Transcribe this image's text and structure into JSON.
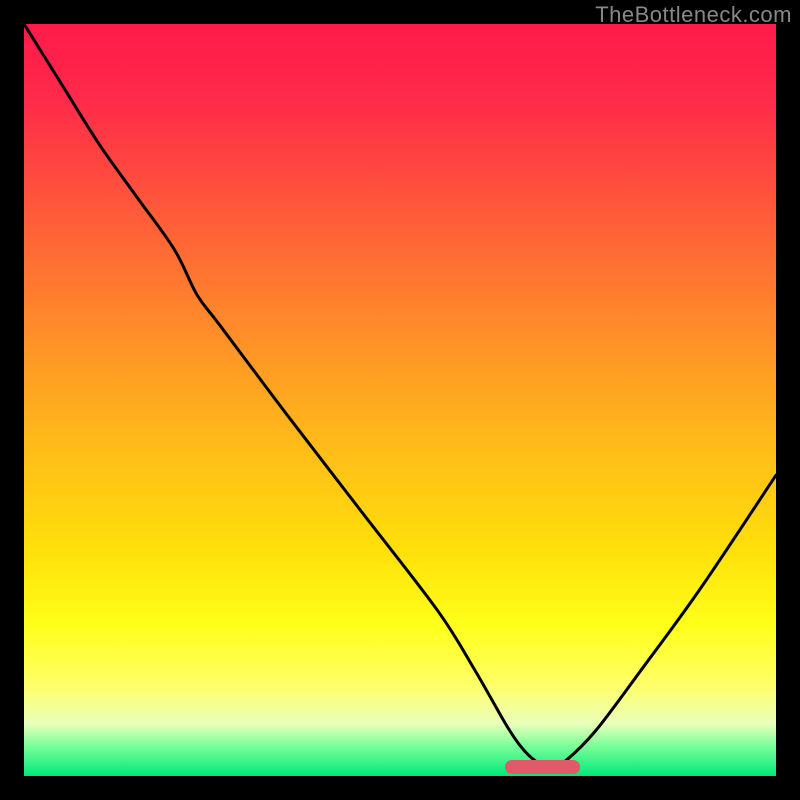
{
  "watermark": "TheBottleneck.com",
  "chart_data": {
    "type": "line",
    "title": "",
    "xlabel": "",
    "ylabel": "",
    "xlim": [
      0,
      100
    ],
    "ylim": [
      0,
      100
    ],
    "grid": false,
    "series": [
      {
        "name": "bottleneck-curve",
        "x": [
          0,
          5,
          10,
          15,
          20,
          23,
          26,
          35,
          45,
          55,
          60,
          64,
          66,
          68,
          70,
          72,
          76,
          82,
          90,
          100
        ],
        "values": [
          100,
          92,
          84,
          77,
          70,
          64,
          60,
          48,
          35,
          22,
          14,
          7,
          4,
          2,
          1,
          2,
          6,
          14,
          25,
          40
        ]
      }
    ],
    "optimal_marker": {
      "x_start": 64,
      "x_end": 74,
      "y": 0
    },
    "gradient_stops": [
      {
        "pos": 0,
        "color": "#ff1a4a"
      },
      {
        "pos": 25,
        "color": "#ff5a3a"
      },
      {
        "pos": 55,
        "color": "#ffb81a"
      },
      {
        "pos": 80,
        "color": "#ffff1a"
      },
      {
        "pos": 100,
        "color": "#00e878"
      }
    ]
  }
}
